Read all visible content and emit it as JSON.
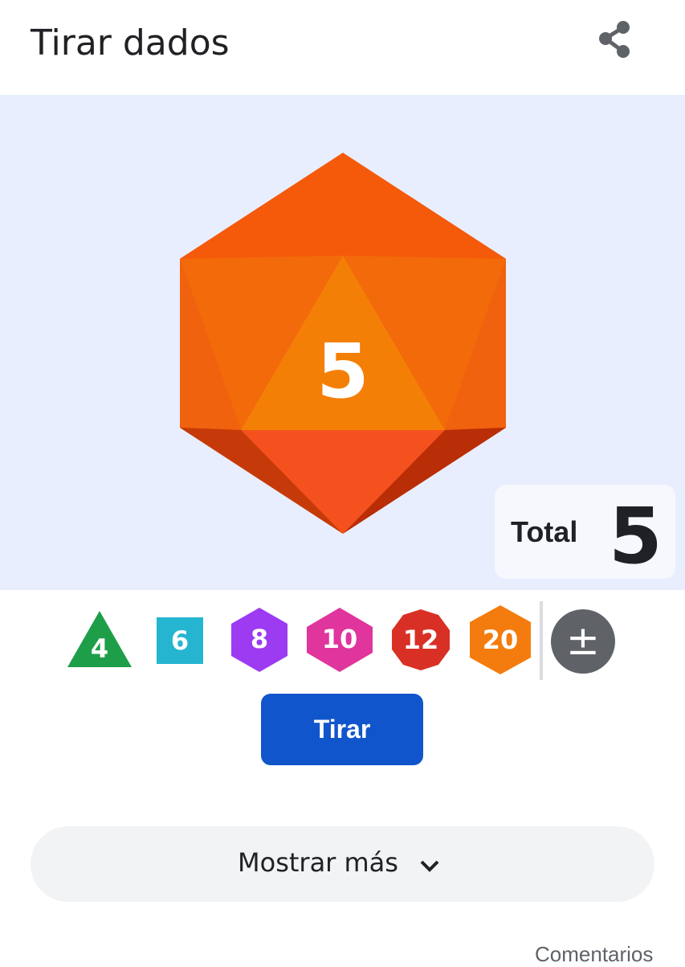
{
  "header": {
    "title": "Tirar dados",
    "share_icon": "share-icon"
  },
  "stage": {
    "die_type": "d20",
    "die_value": "5",
    "die_color": "#f4511e",
    "total_label": "Total",
    "total_value": "5"
  },
  "dice": [
    {
      "label": "4",
      "shape": "triangle",
      "color": "#1e9e49"
    },
    {
      "label": "6",
      "shape": "square",
      "color": "#26b5d1"
    },
    {
      "label": "8",
      "shape": "hexagon",
      "color": "#9c3bf2"
    },
    {
      "label": "10",
      "shape": "hexagon-wide",
      "color": "#e0359c"
    },
    {
      "label": "12",
      "shape": "decagon",
      "color": "#d93025"
    },
    {
      "label": "20",
      "shape": "hexagon-vertical",
      "color": "#f47c0e"
    }
  ],
  "modifier": {
    "label": "±",
    "color": "#5f6368"
  },
  "roll_button": {
    "label": "Tirar",
    "color": "#1155cc"
  },
  "more_button": {
    "label": "Mostrar más",
    "icon": "chevron-down-icon"
  },
  "feedback": {
    "label": "Comentarios"
  }
}
